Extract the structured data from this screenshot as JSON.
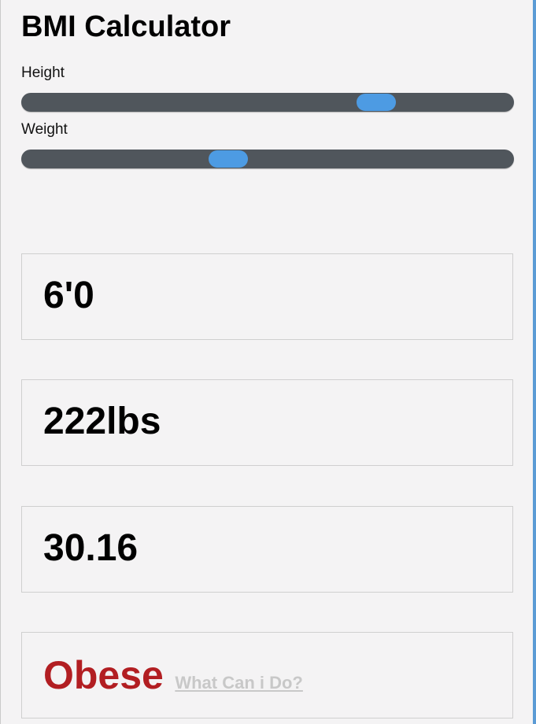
{
  "app": {
    "title": "BMI Calculator"
  },
  "sliders": {
    "height": {
      "label": "Height",
      "level": 0.72
    },
    "weight": {
      "label": "Weight",
      "level": 0.42
    }
  },
  "results": {
    "height_display": "6'0",
    "weight_display": "222lbs",
    "bmi_value": "30.16",
    "category": "Obese",
    "advice_link": "What Can i Do?"
  },
  "colors": {
    "accent": "#4d9be3",
    "track": "#50565c",
    "category": "#b21e22",
    "link": "#c8c8c8",
    "background": "#f4f3f4"
  }
}
